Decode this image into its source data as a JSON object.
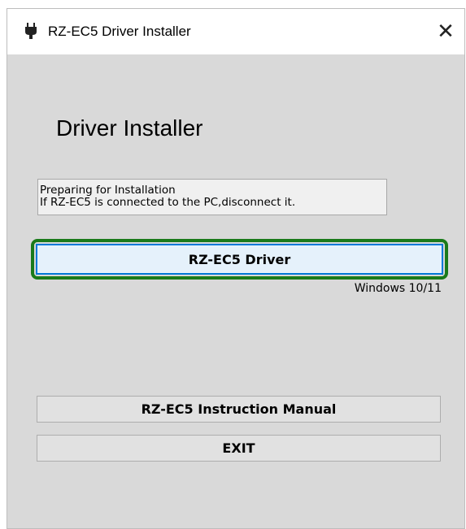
{
  "window": {
    "title": "RZ-EC5 Driver Installer",
    "close_glyph": "✕"
  },
  "main": {
    "heading": "Driver Installer",
    "info_lines": [
      "Preparing for Installation",
      "If RZ-EC5 is connected to the PC,disconnect it."
    ],
    "driver_button": "RZ-EC5 Driver",
    "windows_label": "Windows 10/11",
    "manual_button": "RZ-EC5 Instruction Manual",
    "exit_button": "EXIT"
  },
  "colors": {
    "focus_highlight": "#1a7a1a",
    "button_focus_border": "#0078d7",
    "background": "#d9d9d9"
  },
  "icons": {
    "app_icon": "connector-plug-icon",
    "close_icon": "close-icon"
  }
}
